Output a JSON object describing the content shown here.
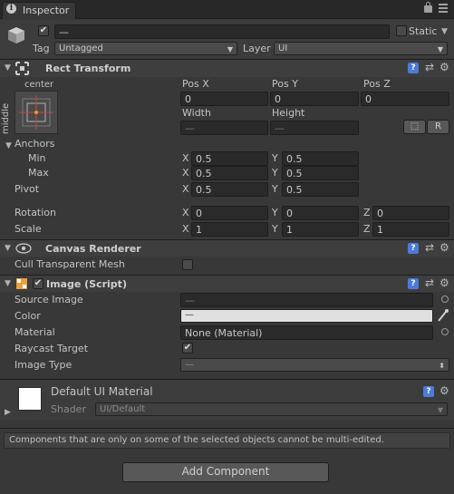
{
  "tab": {
    "icon": "info-icon",
    "title": "Inspector"
  },
  "object": {
    "name": "—",
    "static_label": "Static",
    "tag_label": "Tag",
    "tag_value": "Untagged",
    "layer_label": "Layer",
    "layer_value": "UI"
  },
  "rect_transform": {
    "title": "Rect Transform",
    "anchor_h": "center",
    "anchor_v": "middle",
    "pos_x_label": "Pos X",
    "pos_y_label": "Pos Y",
    "pos_z_label": "Pos Z",
    "pos_x": "0",
    "pos_y": "0",
    "pos_z": "0",
    "width_label": "Width",
    "height_label": "Height",
    "width": "—",
    "height": "—",
    "raw_button": "R",
    "anchors_label": "Anchors",
    "min_label": "Min",
    "max_label": "Max",
    "min_x": "0.5",
    "min_y": "0.5",
    "max_x": "0.5",
    "max_y": "0.5",
    "pivot_label": "Pivot",
    "pivot_x": "0.5",
    "pivot_y": "0.5",
    "rotation_label": "Rotation",
    "rot_x": "0",
    "rot_y": "0",
    "rot_z": "0",
    "scale_label": "Scale",
    "scale_x": "1",
    "scale_y": "1",
    "scale_z": "1",
    "x": "X",
    "y": "Y",
    "z": "Z"
  },
  "canvas_renderer": {
    "title": "Canvas Renderer",
    "cull_label": "Cull Transparent Mesh"
  },
  "image": {
    "title": "Image (Script)",
    "source_image_label": "Source Image",
    "source_image": "—",
    "color_label": "Color",
    "color_value": "—",
    "material_label": "Material",
    "material_value": "None (Material)",
    "raycast_label": "Raycast Target",
    "image_type_label": "Image Type",
    "image_type_value": "—"
  },
  "material": {
    "title": "Default UI Material",
    "shader_label": "Shader",
    "shader_value": "UI/Default"
  },
  "notice": "Components that are only on some of the selected objects cannot be multi-edited.",
  "add_component": "Add Component"
}
